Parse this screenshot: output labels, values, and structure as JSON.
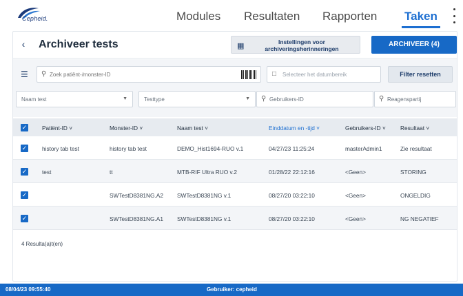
{
  "app": {
    "logo_text": "Cepheid."
  },
  "nav": {
    "modules": "Modules",
    "resultaten": "Resultaten",
    "rapporten": "Rapporten",
    "taken": "Taken"
  },
  "header": {
    "title": "Archiveer tests",
    "settings_button": "Instellingen voor archiveringsherinneringen",
    "archive_button": "ARCHIVEER (4)"
  },
  "filters": {
    "search_placeholder": "Zoek patiënt-/monster-ID",
    "date_placeholder": "Selecteer het datumbereik",
    "reset_button": "Filter resetten",
    "test_name": "Naam test",
    "test_type": "Testtype",
    "user_id": "Gebruikers-ID",
    "reagent_lot": "Reagenspartij"
  },
  "table": {
    "columns": [
      "Patiënt-ID ˅",
      "Monster-ID ˅",
      "Naam test ˅",
      "Einddatum en -tijd ˅",
      "Gebruikers-ID ˅",
      "Resultaat ˅"
    ],
    "rows": [
      [
        "history tab test",
        "history tab test",
        "DEMO_Hist1694-RUO v.1",
        "04/27/23 11:25:24",
        "masterAdmin1",
        "Zie resultaat"
      ],
      [
        "test",
        "tt",
        "MTB-RIF Ultra RUO v.2",
        "01/28/22 22:12:16",
        "<Geen>",
        "STORING"
      ],
      [
        "",
        "SWTestD8381NG.A2",
        "SWTestD8381NG v.1",
        "08/27/20 03:22:10",
        "<Geen>",
        "ONGELDIG"
      ],
      [
        "",
        "SWTestD8381NG.A1",
        "SWTestD8381NG v.1",
        "08/27/20 03:22:10",
        "<Geen>",
        "NG NEGATIEF"
      ]
    ],
    "count": "4 Resulta(a)t(en)"
  },
  "status": {
    "datetime": "08/04/23 09:55:40",
    "user": "Gebruiker: cepheid"
  },
  "colors": {
    "accent": "#1769c6",
    "active_nav": "#1d6fd1"
  }
}
